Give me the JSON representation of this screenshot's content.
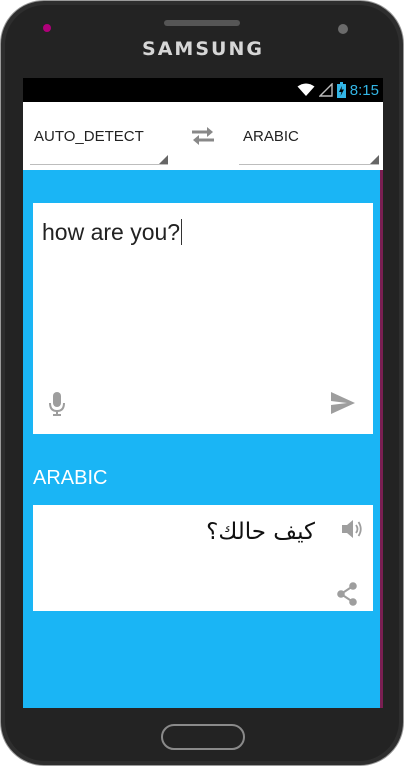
{
  "device": {
    "brand": "SAMSUNG"
  },
  "statusbar": {
    "time": "8:15"
  },
  "source_language": {
    "selected": "AUTO_DETECT"
  },
  "target_language": {
    "selected": "ARABIC"
  },
  "input": {
    "text": "how are you?"
  },
  "output": {
    "language_label": "ARABIC",
    "translation": "كيف حالك؟"
  },
  "colors": {
    "background": "#1ab5f5",
    "card": "#ffffff",
    "accent": "#33b5e5"
  }
}
